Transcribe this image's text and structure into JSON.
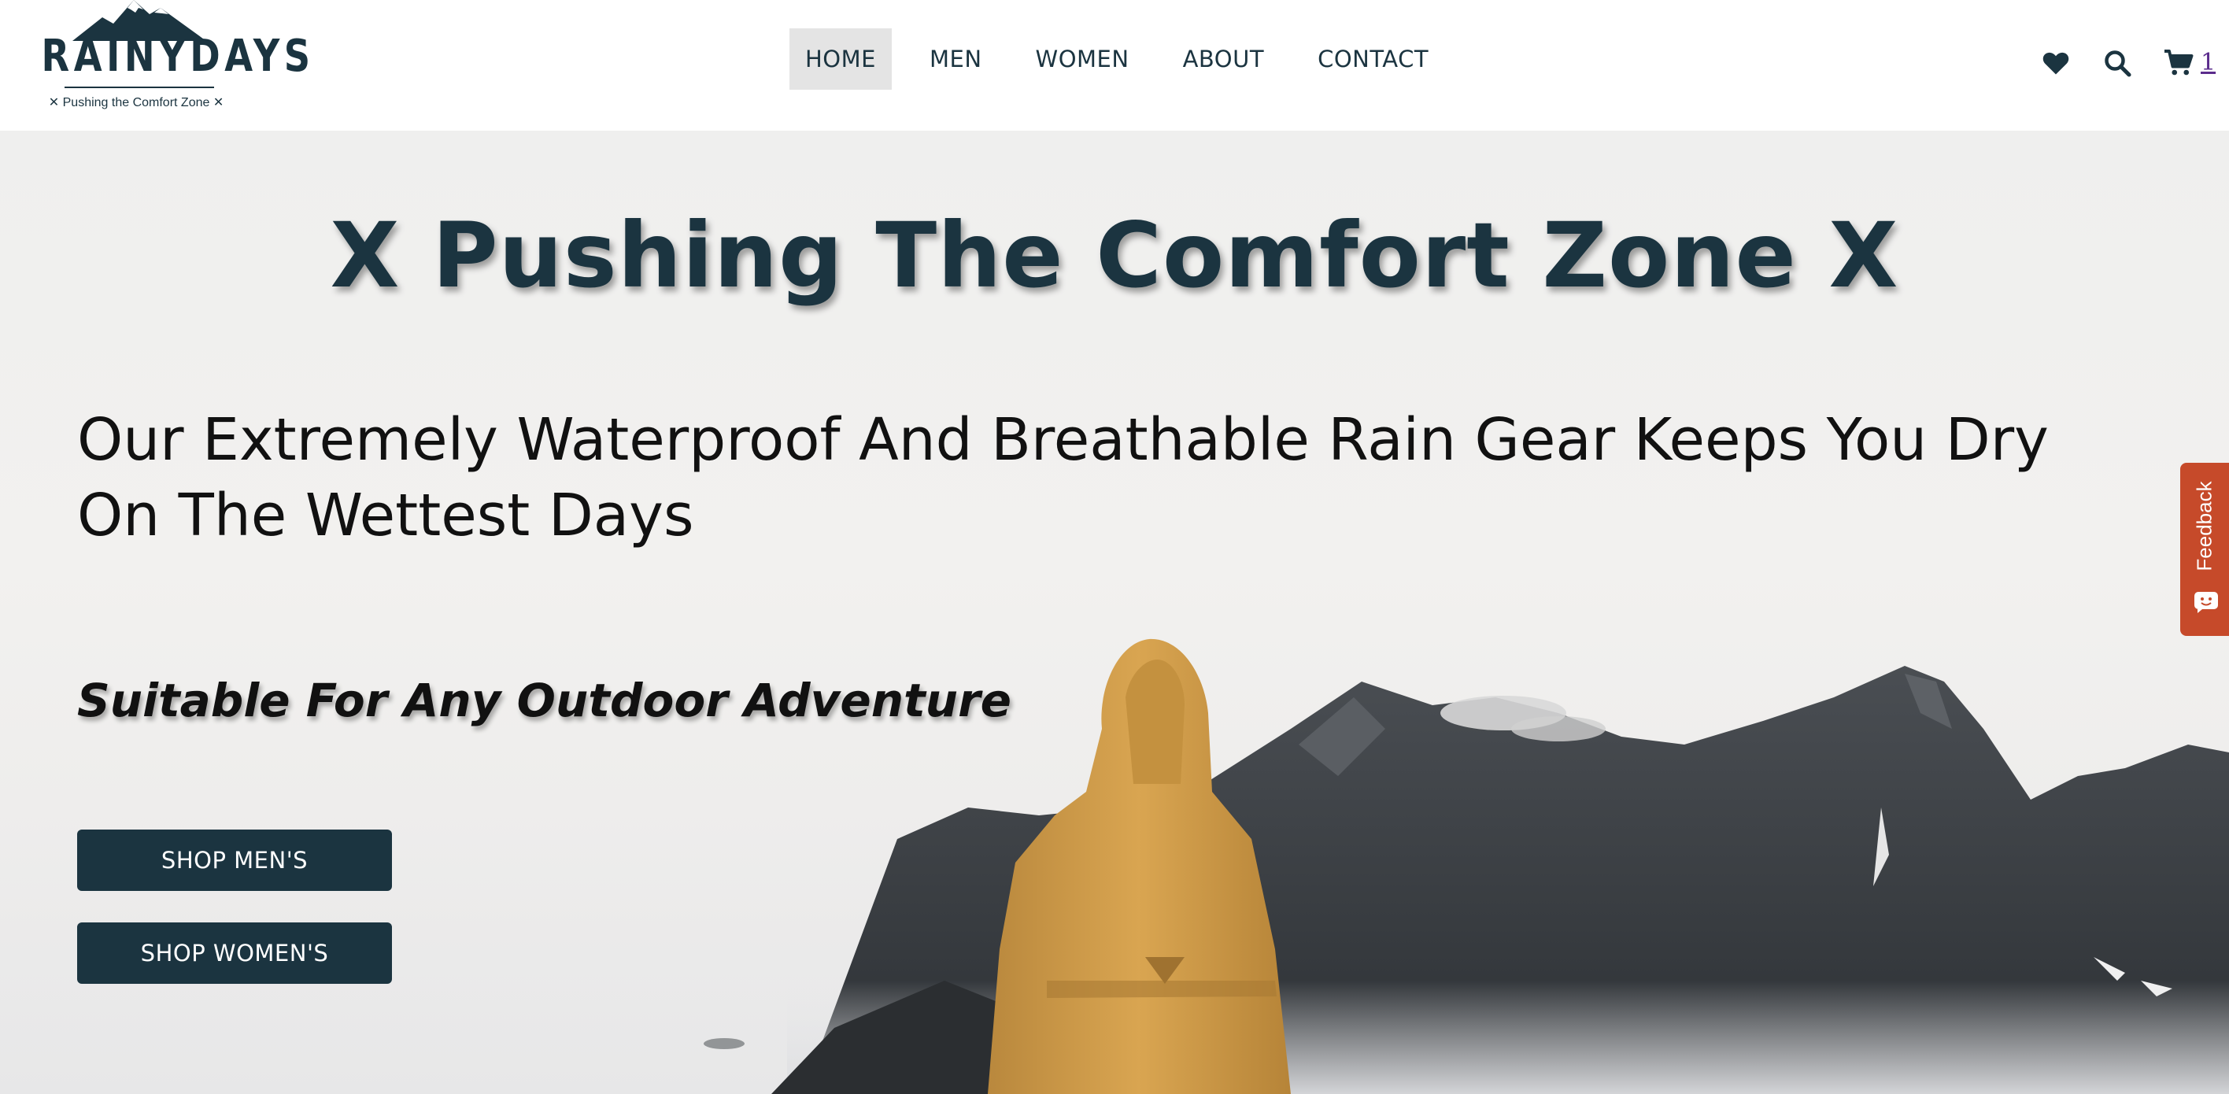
{
  "header": {
    "logo": {
      "word": "RAINYDAYS",
      "tagline": "✕ Pushing the Comfort Zone ✕"
    },
    "nav": [
      {
        "label": "HOME",
        "active": true
      },
      {
        "label": "MEN",
        "active": false
      },
      {
        "label": "WOMEN",
        "active": false
      },
      {
        "label": "ABOUT",
        "active": false
      },
      {
        "label": "CONTACT",
        "active": false
      }
    ],
    "icons": [
      "heart-icon",
      "search-icon",
      "cart-icon"
    ],
    "cart_count": "1"
  },
  "hero": {
    "title": "X Pushing The Comfort Zone X",
    "subtitle": "Our Extremely Waterproof And Breathable Rain Gear Keeps You Dry On The Wettest Days",
    "tagline": "Suitable For Any Outdoor Adventure",
    "buttons": {
      "men": "SHOP MEN'S",
      "women": "SHOP WOMEN'S"
    }
  },
  "feedback": {
    "label": "Feedback",
    "icon": "smiley-chat-icon"
  },
  "colors": {
    "brand": "#1b3440",
    "nav_active_bg": "#e4e4e4",
    "feedback": "#c64a2a",
    "cart_link": "#5b2c8c",
    "jacket": "#d6a24e"
  }
}
